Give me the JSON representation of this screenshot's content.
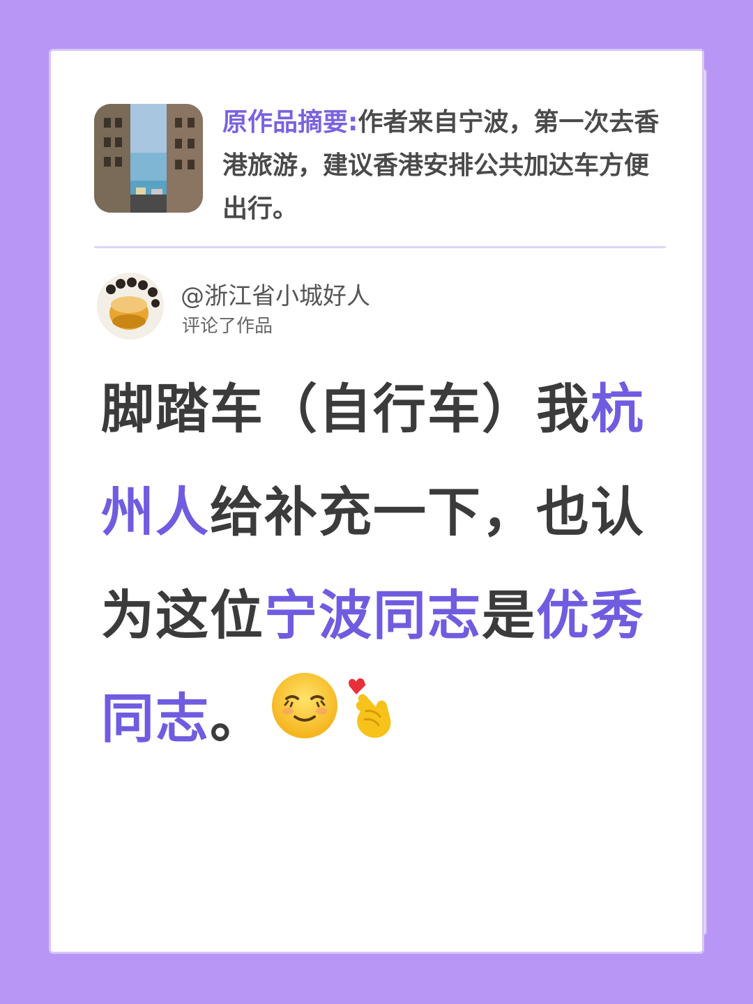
{
  "summary": {
    "label": "原作品摘要:",
    "text": "作者来自宁波，第一次去香港旅游，建议香港安排公共加达车方便出行。"
  },
  "commenter": {
    "name": "@浙江省小城好人",
    "action": "评论了作品"
  },
  "comment": {
    "parts": [
      "脚踏车（自行车）我",
      "杭州人",
      "给补充一下，也认为这位",
      "宁波同志",
      "是",
      "优秀同志",
      "。"
    ]
  },
  "colors": {
    "background": "#b896f5",
    "accent": "#6f5ce0",
    "text": "#3b3b3b"
  },
  "icons": [
    "smiling-face-emoji",
    "finger-heart-emoji"
  ]
}
